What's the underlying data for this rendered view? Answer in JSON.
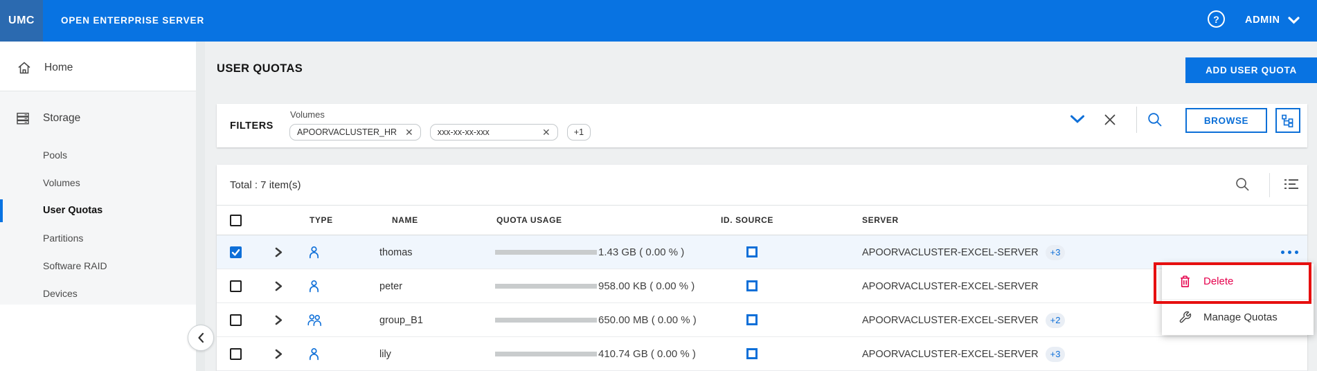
{
  "topbar": {
    "logo": "UMC",
    "product_name": "OPEN ENTERPRISE SERVER",
    "help_icon": "help-circle-icon",
    "user_label": "ADMIN",
    "user_chevron_icon": "chevron-down-icon"
  },
  "sidebar": {
    "home_label": "Home",
    "home_icon": "home-icon",
    "storage_label": "Storage",
    "storage_icon": "storage-server-icon",
    "storage_items": [
      "Pools",
      "Volumes",
      "User Quotas",
      "Partitions",
      "Software RAID",
      "Devices"
    ],
    "active_item": "User Quotas",
    "collapse_icon": "chevron-left-icon"
  },
  "page": {
    "title": "USER QUOTAS",
    "add_button": "ADD USER QUOTA"
  },
  "filters": {
    "label": "FILTERS",
    "group_label": "Volumes",
    "chips": [
      {
        "text": "APOORVACLUSTER_HR",
        "remove_icon": "close-icon"
      },
      {
        "text": "xxx-xx-xx-xxx",
        "remove_icon": "close-icon"
      }
    ],
    "overflow_chip": "+1",
    "collapse_icon": "chevron-down-icon",
    "clear_icon": "close-icon",
    "search_icon": "search-icon",
    "browse_button": "BROWSE",
    "object_tree_icon": "tree-structure-icon"
  },
  "table": {
    "total_label": "Total : 7 item(s)",
    "search_icon": "search-icon",
    "column_settings_icon": "list-settings-icon",
    "columns": [
      "TYPE",
      "NAME",
      "QUOTA USAGE",
      "ID. SOURCE",
      "SERVER"
    ],
    "rows": [
      {
        "type": "user",
        "type_icon": "user-icon",
        "name": "thomas",
        "quota_usage": "1.43 GB ( 0.00 % )",
        "id_source_icon": "square-outline-icon",
        "server": "APOORVACLUSTER-EXCEL-SERVER",
        "server_badge": "+3",
        "selected": true,
        "row_menu_icon": "ellipsis-icon"
      },
      {
        "type": "user",
        "type_icon": "user-icon",
        "name": "peter",
        "quota_usage": "958.00 KB ( 0.00 % )",
        "id_source_icon": "square-outline-icon",
        "server": "APOORVACLUSTER-EXCEL-SERVER",
        "selected": false
      },
      {
        "type": "group",
        "type_icon": "group-icon",
        "name": "group_B1",
        "quota_usage": "650.00 MB ( 0.00 % )",
        "id_source_icon": "square-outline-icon",
        "server": "APOORVACLUSTER-EXCEL-SERVER",
        "server_badge": "+2",
        "selected": false
      },
      {
        "type": "user",
        "type_icon": "user-icon",
        "name": "lily",
        "quota_usage": "410.74 GB ( 0.00 % )",
        "id_source_icon": "square-outline-icon",
        "server": "APOORVACLUSTER-EXCEL-SERVER",
        "server_badge": "+3",
        "selected": false
      }
    ]
  },
  "context_menu": {
    "items": [
      {
        "label": "Delete",
        "icon": "trash-icon",
        "highlighted": true
      },
      {
        "label": "Manage Quotas",
        "icon": "wrench-icon",
        "highlighted": false
      }
    ]
  },
  "annotation": {
    "type": "red-highlight-box",
    "target": "Delete"
  },
  "colors": {
    "topbar_blue": "#0873e2",
    "logo_blue": "#2b6ab0",
    "accent_blue": "#0e6fd8",
    "selected_row_bg": "#f0f6fd",
    "content_bg": "#eef0f1",
    "sidebar_section_bg": "#f5f6f7",
    "delete_pink": "#e5004c",
    "annotation_red": "#e60f0f",
    "progress_track": "#c9cccd"
  }
}
